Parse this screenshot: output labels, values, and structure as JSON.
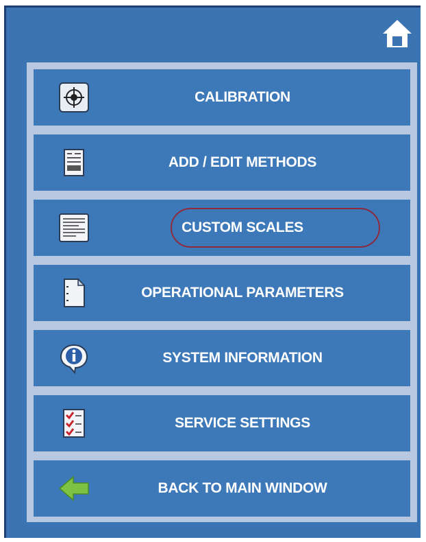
{
  "header": {
    "home_icon": "home-icon"
  },
  "menu": {
    "items": [
      {
        "label": "CALIBRATION",
        "icon": "crosshair-icon"
      },
      {
        "label": "ADD / EDIT METHODS",
        "icon": "document-list-icon"
      },
      {
        "label": "CUSTOM SCALES",
        "icon": "text-page-icon",
        "highlighted": true
      },
      {
        "label": "OPERATIONAL PARAMETERS",
        "icon": "blank-page-icon"
      },
      {
        "label": "SYSTEM INFORMATION",
        "icon": "info-icon"
      },
      {
        "label": "SERVICE SETTINGS",
        "icon": "checklist-icon"
      },
      {
        "label": "BACK TO MAIN WINDOW",
        "icon": "back-arrow-icon"
      }
    ]
  },
  "colors": {
    "background": "#3a74b3",
    "frame": "#b7c8e0",
    "button": "#3d79b8",
    "highlight": "#8e2a3c",
    "arrow": "#7ec243"
  }
}
